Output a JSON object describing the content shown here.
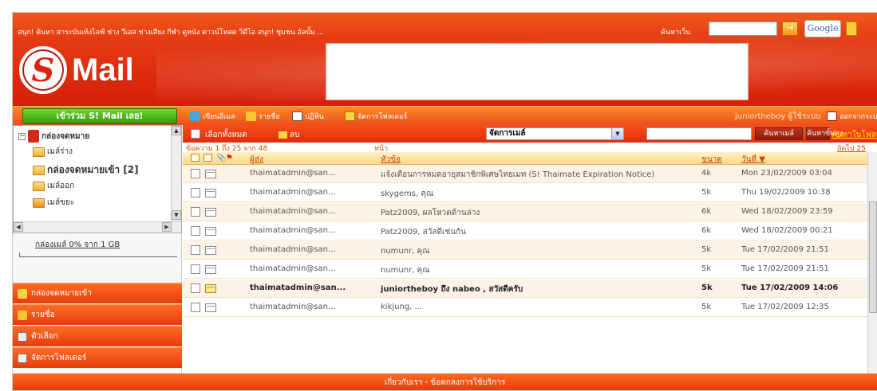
{
  "colors": {
    "brand": "#e3220d",
    "toolbar": "#f27024",
    "join": "#3fae13",
    "link": "#ffee00"
  },
  "header": {
    "topnav": "สนุก! ค้นหา สาระบันเทิงไลฟ์ ช่าง วีเอส ช่างเสียง กีฬา ดูหนัง ดาวน์โหลด วิดีโอ สนุก! ชุมชน อัลบั้ม ...",
    "search_label": "ค้นหาเว็บ",
    "search_placeholder": "",
    "search_button": "→",
    "google_label": "Google",
    "logo_s": "S",
    "logo_text": "Mail"
  },
  "toolbar": {
    "join_label": "เข้าร่วม S! Mail เลย!",
    "items": [
      {
        "label": "เขียนอีเมล",
        "icon": "compose-icon"
      },
      {
        "label": "รายชื่อ",
        "icon": "contacts-icon"
      },
      {
        "label": "ปฏิทิน",
        "icon": "calendar-icon"
      },
      {
        "label": "จัดการโฟลเดอร์",
        "icon": "folder-icon"
      }
    ],
    "user": "juniortheboy ผู้ใช้ระบบ",
    "logout": "ออกจากระบบ"
  },
  "sidebar": {
    "tree": [
      {
        "label": "กล่องจดหมาย",
        "icon": "inbox-icon"
      },
      {
        "label": "เมล์ร่าง",
        "icon": "folder-icon"
      },
      {
        "label": "กล่องจดหมายเข้า [2]",
        "icon": "folder-icon"
      },
      {
        "label": "เมล์ออก",
        "icon": "folder-icon"
      },
      {
        "label": "เมล์ขยะ",
        "icon": "folder-icon"
      }
    ],
    "storage": "กล่องเมล์ 0% จาก 1 GB",
    "nav": [
      {
        "label": "กล่องจดหมายเข้า",
        "icon": "mailbox-icon"
      },
      {
        "label": "รายชื่อ",
        "icon": "contacts-icon"
      },
      {
        "label": "ตัวเลือก",
        "icon": "options-icon"
      },
      {
        "label": "จัดการโฟลเดอร์",
        "icon": "folder-icon"
      }
    ]
  },
  "actions": {
    "select_all": "เลือกทั้งหมด",
    "delete": "ลบ",
    "move_to": "จัดการเมล์",
    "search_mail": "ค้นหาเมล์",
    "advanced_search": "ค้นหาขั้นสูง",
    "link": "ค้นหาในโฟลเดอร์อื่น"
  },
  "info": {
    "range": "ข้อความ 1 ถึง 25 จาก 48",
    "next": "หน้า",
    "next_page": "ถัดไป 25"
  },
  "columns": {
    "from": "ผู้ส่ง",
    "subject": "หัวข้อ",
    "size": "ขนาด",
    "date": "วันที่ ▼"
  },
  "emails": [
    {
      "from": "thaimatadmin@san...",
      "subject": "แจ้งเตือนการหมดอายุสมาชิกพิเศษไทยเมท (S! Thaimate Expiration Notice)",
      "size": "4k",
      "date": "Mon 23/02/2009 03:04",
      "unread": false
    },
    {
      "from": "thaimatadmin@san...",
      "subject": "skygems, คุณ",
      "size": "5k",
      "date": "Thu 19/02/2009 10:38",
      "unread": false
    },
    {
      "from": "thaimatadmin@san...",
      "subject": "Patz2009, ผลโหวตด้านล่าง",
      "size": "6k",
      "date": "Wed 18/02/2009 23:59",
      "unread": false
    },
    {
      "from": "thaimatadmin@san...",
      "subject": "Patz2009, สวัสดีเช่นกัน",
      "size": "6k",
      "date": "Wed 18/02/2009 00:21",
      "unread": false
    },
    {
      "from": "thaimatadmin@san...",
      "subject": "numunr, คุณ",
      "size": "5k",
      "date": "Tue 17/02/2009 21:51",
      "unread": false
    },
    {
      "from": "thaimatadmin@san...",
      "subject": "numunr, คุณ",
      "size": "5k",
      "date": "Tue 17/02/2009 21:51",
      "unread": false
    },
    {
      "from": "thaimatadmin@san...",
      "subject": "juniortheboy ถึง nabeo , สวัสดีครับ",
      "size": "5k",
      "date": "Tue 17/02/2009 14:06",
      "unread": true
    },
    {
      "from": "thaimatadmin@san...",
      "subject": "kikjung, ...",
      "size": "5k",
      "date": "Tue 17/02/2009 12:35",
      "unread": false
    }
  ],
  "footer": "เกี่ยวกับเรา - ข้อตกลงการใช้บริการ"
}
